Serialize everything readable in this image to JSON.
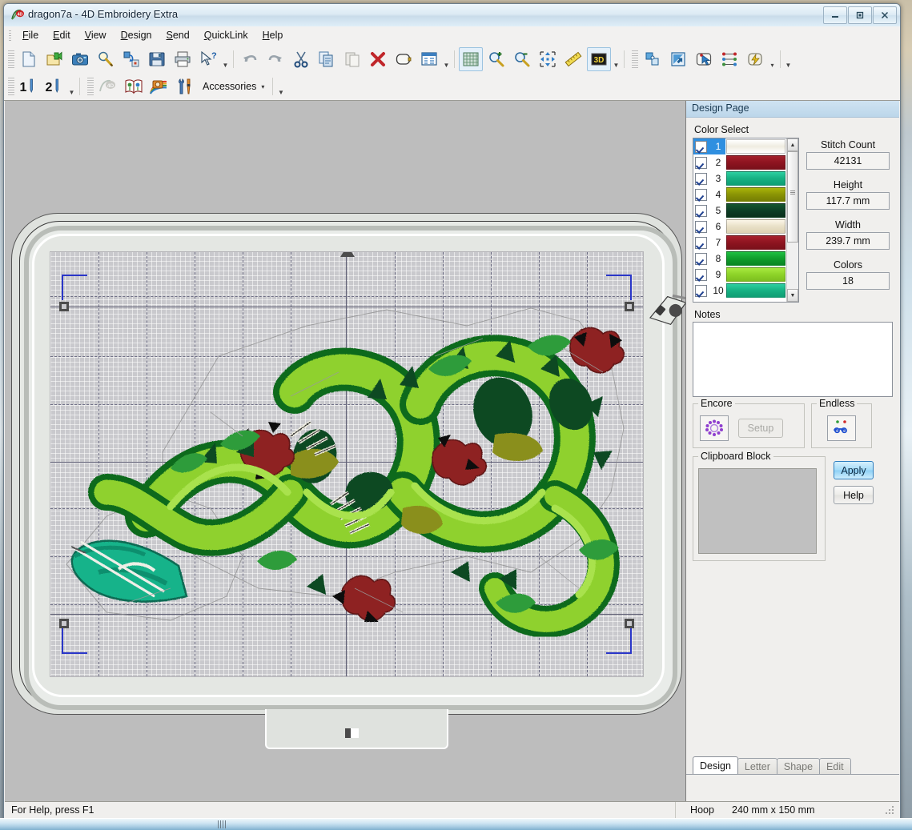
{
  "window": {
    "title": "dragon7a - 4D Embroidery Extra",
    "app_icon": "4d-logo-icon",
    "controls": {
      "minimize": "–",
      "maximize": "□",
      "close": "✕"
    }
  },
  "menu": {
    "items": [
      {
        "label": "File",
        "accel": "F"
      },
      {
        "label": "Edit",
        "accel": "E"
      },
      {
        "label": "View",
        "accel": "V"
      },
      {
        "label": "Design",
        "accel": "D"
      },
      {
        "label": "Send",
        "accel": "S"
      },
      {
        "label": "QuickLink",
        "accel": "Q"
      },
      {
        "label": "Help",
        "accel": "H"
      }
    ]
  },
  "toolbar_main": {
    "buttons": [
      {
        "name": "new-document-button",
        "icon": "page-icon"
      },
      {
        "name": "open-design-button",
        "icon": "open-folder-icon"
      },
      {
        "name": "capture-button",
        "icon": "camera-icon"
      },
      {
        "name": "preview-button",
        "icon": "magnifier-pencil-icon"
      },
      {
        "name": "export-button",
        "icon": "export-blocks-icon"
      },
      {
        "name": "save-button",
        "icon": "floppy-disk-icon"
      },
      {
        "name": "print-button",
        "icon": "printer-icon"
      },
      {
        "name": "context-help-button",
        "icon": "cursor-question-icon"
      },
      {
        "name": "undo-button",
        "icon": "undo-arrow-icon"
      },
      {
        "name": "redo-button",
        "icon": "redo-arrow-icon"
      },
      {
        "name": "cut-button",
        "icon": "scissors-icon"
      },
      {
        "name": "copy-button",
        "icon": "copy-pages-icon"
      },
      {
        "name": "paste-button",
        "icon": "paste-icon"
      },
      {
        "name": "delete-button",
        "icon": "red-x-icon"
      },
      {
        "name": "hoop-button",
        "icon": "hoop-ring-icon"
      },
      {
        "name": "design-properties-button",
        "icon": "window-list-icon"
      },
      {
        "name": "grid-button",
        "icon": "grid-icon"
      },
      {
        "name": "zoom-in-button",
        "icon": "magnifier-plus-icon"
      },
      {
        "name": "zoom-out-button",
        "icon": "magnifier-minus-icon"
      },
      {
        "name": "pan-button",
        "icon": "four-way-arrows-icon"
      },
      {
        "name": "measure-button",
        "icon": "ruler-icon"
      },
      {
        "name": "three-d-button",
        "icon": "3d-icon"
      },
      {
        "name": "combine-button",
        "icon": "blue-squares-icon"
      },
      {
        "name": "modify-block-button",
        "icon": "blue-flag-arrow-icon"
      },
      {
        "name": "select-block-button",
        "icon": "select-arrow-icon"
      },
      {
        "name": "color-change-button",
        "icon": "color-dots-icon"
      },
      {
        "name": "quick-stitch-button",
        "icon": "lightning-icon"
      }
    ],
    "grid_active": true,
    "three_d_active": true
  },
  "toolbar_secondary": {
    "buttons": [
      {
        "name": "needle-1-button",
        "icon": "needle-1-icon",
        "label": "1"
      },
      {
        "name": "needle-2-button",
        "icon": "needle-2-icon",
        "label": "2"
      },
      {
        "name": "4d-suite-button",
        "icon": "4d-logo-icon"
      },
      {
        "name": "catalog-button",
        "icon": "open-book-icon"
      },
      {
        "name": "rainbow-gallery-button",
        "icon": "rainbow-camera-icon"
      },
      {
        "name": "configure-button",
        "icon": "tools-icon"
      }
    ],
    "accessories_label": "Accessories",
    "accessories_chevron": "▾"
  },
  "design_page": {
    "panel_title": "Design Page",
    "color_select": {
      "label": "Color Select",
      "rows": [
        {
          "index": "1",
          "checked": true,
          "color": "#f2f0e6",
          "color2": "#ffffff",
          "selected": true
        },
        {
          "index": "2",
          "checked": true,
          "color": "#8e1420",
          "color2": "#a5202c",
          "selected": false
        },
        {
          "index": "3",
          "checked": true,
          "color": "#16b183",
          "color2": "#2ccfa0",
          "selected": false
        },
        {
          "index": "4",
          "checked": true,
          "color": "#8a9405",
          "color2": "#a9b509",
          "selected": false
        },
        {
          "index": "5",
          "checked": true,
          "color": "#0d3f26",
          "color2": "#14562f",
          "selected": false
        },
        {
          "index": "6",
          "checked": true,
          "color": "#e9e0c7",
          "color2": "#f6efdd",
          "selected": false
        },
        {
          "index": "7",
          "checked": true,
          "color": "#8e1420",
          "color2": "#a8212e",
          "selected": false
        },
        {
          "index": "8",
          "checked": true,
          "color": "#0f9e2c",
          "color2": "#1ec042",
          "selected": false
        },
        {
          "index": "9",
          "checked": true,
          "color": "#8dd328",
          "color2": "#a8e83f",
          "selected": false
        },
        {
          "index": "10",
          "checked": true,
          "color": "#16b183",
          "color2": "#2ccfa0",
          "selected": false
        }
      ],
      "scroll_up_glyph": "▲",
      "scroll_down_glyph": "▼"
    },
    "info": {
      "stitch_count_label": "Stitch Count",
      "stitch_count_value": "42131",
      "height_label": "Height",
      "height_value": "117.7 mm",
      "width_label": "Width",
      "width_value": "239.7 mm",
      "colors_label": "Colors",
      "colors_value": "18"
    },
    "notes": {
      "label": "Notes",
      "value": "",
      "placeholder": ""
    },
    "encore": {
      "label": "Encore",
      "icon": "encore-flower-ring-icon",
      "setup_label": "Setup",
      "setup_disabled": true
    },
    "endless": {
      "label": "Endless",
      "icon": "endless-swirl-icon"
    },
    "clipboard_block": {
      "label": "Clipboard Block"
    },
    "buttons": {
      "apply_label": "Apply",
      "help_label": "Help"
    },
    "tabs": [
      {
        "label": "Design",
        "active": true
      },
      {
        "label": "Letter",
        "active": false
      },
      {
        "label": "Shape",
        "active": false
      },
      {
        "label": "Edit",
        "active": false
      }
    ]
  },
  "status_bar": {
    "hint": "For Help, press F1",
    "hoop_label": "Hoop",
    "hoop_value": "240 mm x 150 mm"
  },
  "canvas": {
    "design_name": "dragon7a",
    "subject": "green-dragon-embroidery",
    "hoop_type": "embroidery-hoop",
    "grid_visible": true
  },
  "colors": {
    "accent": "#2f8fe0",
    "panel_bg": "#f0efed",
    "canvas_bg": "#bdbdbd",
    "hoop_body": "#dfe2de",
    "design_bg": "#c9c9cd",
    "marker_blue": "#2a36c8"
  }
}
